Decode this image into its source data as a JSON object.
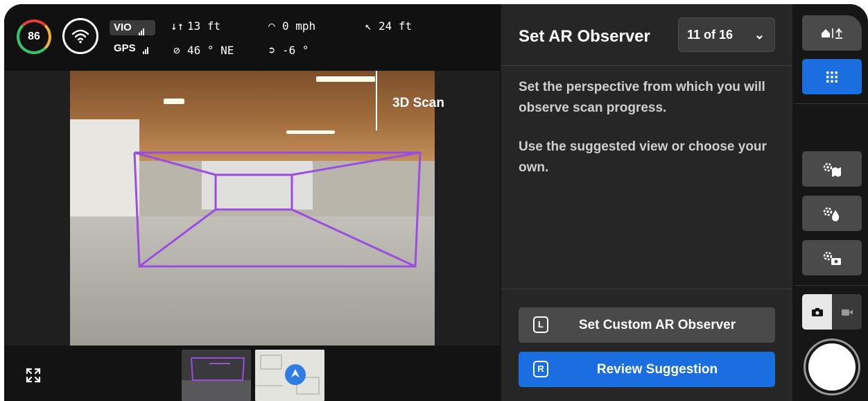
{
  "telemetry": {
    "battery": "86",
    "vio_label": "VIO",
    "gps_label": "GPS",
    "altitude": "13 ft",
    "heading": "46 ° NE",
    "speed": "0 mph",
    "gimbal": "-6 °",
    "distance": "24 ft",
    "icons": {
      "altitude": "up-down-arrows-icon",
      "heading": "compass-icon",
      "speed": "speedometer-icon",
      "gimbal": "camera-pitch-icon",
      "distance": "home-distance-icon"
    }
  },
  "camera": {
    "overlay_label": "3D Scan",
    "overlay_color": "#9b4de0"
  },
  "panel": {
    "title": "Set AR Observer",
    "counter": "11 of 16",
    "description_1": "Set the perspective from which you will observe scan progress.",
    "description_2": "Use the suggested view or choose your own.",
    "custom_button": {
      "key": "L",
      "label": "Set Custom AR Observer"
    },
    "review_button": {
      "key": "R",
      "label": "Review Suggestion"
    }
  },
  "colors": {
    "accent_blue": "#1a6ee0",
    "battery_green": "#37c46b",
    "panel_bg": "#262626"
  }
}
